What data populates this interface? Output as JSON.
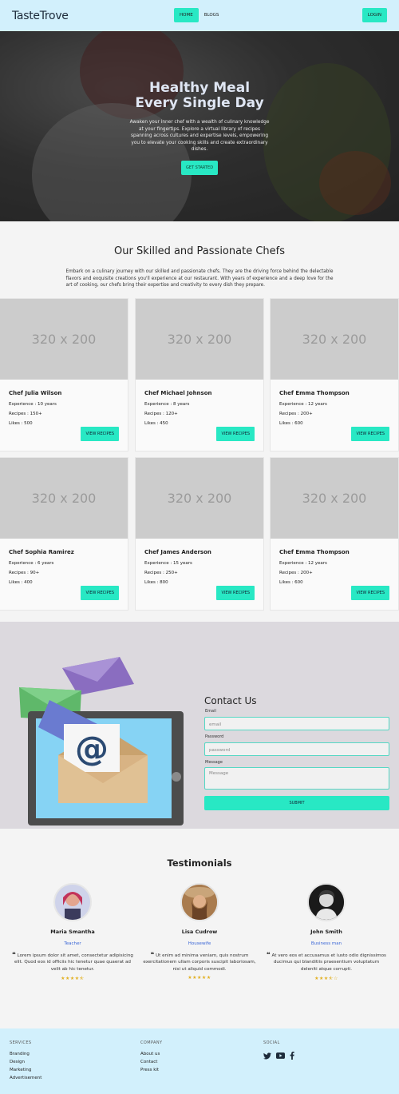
{
  "nav": {
    "brand": "TasteTrove",
    "links": [
      "HOME",
      "BLOGS"
    ],
    "login": "LOGIN"
  },
  "hero": {
    "title_line1": "Healthy Meal",
    "title_line2": "Every Single Day",
    "text": "Awaken your inner chef with a wealth of culinary knowledge at your fingertips. Explore a virtual library of recipes spanning across cultures and expertise levels, empowering you to elevate your cooking skills and create extraordinary dishes.",
    "button": "GET STARTED"
  },
  "chefs": {
    "title": "Our Skilled and Passionate Chefs",
    "description": "Embark on a culinary journey with our skilled and passionate chefs. They are the driving force behind the delectable flavors and exquisite creations you'll experience at our restaurant. With years of experience and a deep love for the art of cooking, our chefs bring their expertise and creativity to every dish they prepare.",
    "placeholder": "320 x 200",
    "button": "VIEW RECIPES",
    "cards": [
      {
        "name": "Chef Julia Wilson",
        "experience": "Experience : 10 years",
        "recipes": "Recipes : 150+",
        "likes": "Likes : 500"
      },
      {
        "name": "Chef Michael Johnson",
        "experience": "Experience : 8 years",
        "recipes": "Recipes : 120+",
        "likes": "Likes : 450"
      },
      {
        "name": "Chef Emma Thompson",
        "experience": "Experience : 12 years",
        "recipes": "Recipes : 200+",
        "likes": "Likes : 600"
      },
      {
        "name": "Chef Sophia Ramirez",
        "experience": "Experience : 6 years",
        "recipes": "Recipes : 90+",
        "likes": "Likes : 400"
      },
      {
        "name": "Chef James Anderson",
        "experience": "Experience : 15 years",
        "recipes": "Recipes : 250+",
        "likes": "Likes : 800"
      },
      {
        "name": "Chef Emma Thompson",
        "experience": "Experience : 12 years",
        "recipes": "Recipes : 200+",
        "likes": "Likes : 600"
      }
    ]
  },
  "contact": {
    "title": "Contact Us",
    "email_label": "Email",
    "email_placeholder": "email",
    "password_label": "Password",
    "password_placeholder": "password",
    "message_label": "Message",
    "message_placeholder": "Message",
    "submit": "SUBMIT"
  },
  "testimonials": {
    "title": "Testimonials",
    "items": [
      {
        "name": "Maria Smantha",
        "role": "Teacher",
        "quote": "Lorem ipsum dolor sit amet, consectetur adipisicing elit. Quod eos id officiis hic tenetur quae quaerat ad velit ab hic tenetur.",
        "rating": 4.5
      },
      {
        "name": "Lisa Cudrow",
        "role": "Housewife",
        "quote": "Ut enim ad minima veniam, quis nostrum exercitationem ullam corporis suscipit laboriosam, nisi ut aliquid commodi.",
        "rating": 5
      },
      {
        "name": "John Smith",
        "role": "Business man",
        "quote": "At vero eos et accusamus et iusto odio dignissimos ducimus qui blanditiis praesentium voluptatum deleniti atque corrupti.",
        "rating": 3.5
      }
    ]
  },
  "footer": {
    "services_head": "SERVICES",
    "services": [
      "Branding",
      "Design",
      "Marketing",
      "Advertisement"
    ],
    "company_head": "COMPANY",
    "company": [
      "About us",
      "Contact",
      "Press kit"
    ],
    "social_head": "SOCIAL",
    "social_icons": [
      "twitter-icon",
      "youtube-icon",
      "facebook-icon"
    ]
  },
  "colors": {
    "accent": "#28e8c4",
    "nav_bg": "#d2f0fc",
    "role": "#3a66d6",
    "star": "#e2b021"
  }
}
